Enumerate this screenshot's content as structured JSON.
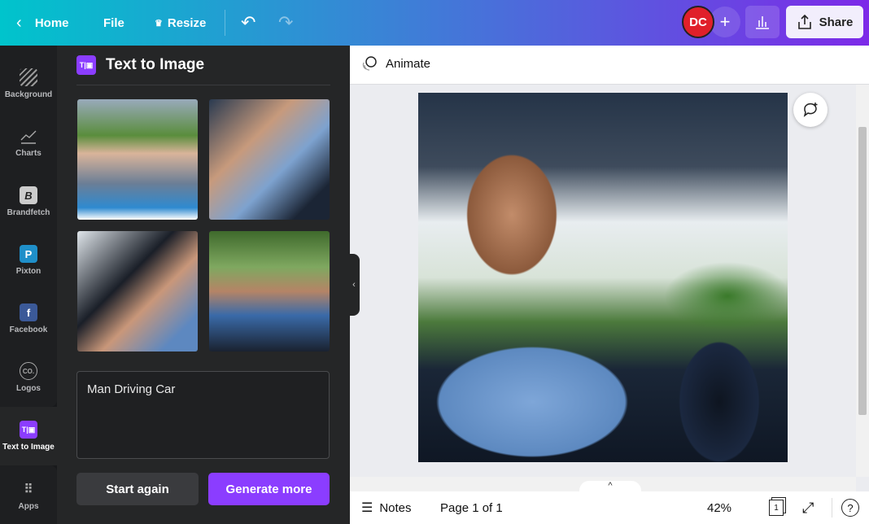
{
  "topbar": {
    "home": "Home",
    "file": "File",
    "resize": "Resize",
    "avatar_initials": "DC",
    "share": "Share"
  },
  "rail": [
    {
      "label": "Background",
      "icon": "background-icon"
    },
    {
      "label": "Charts",
      "icon": "charts-icon"
    },
    {
      "label": "Brandfetch",
      "icon": "brandfetch-icon"
    },
    {
      "label": "Pixton",
      "icon": "pixton-icon"
    },
    {
      "label": "Facebook",
      "icon": "facebook-icon"
    },
    {
      "label": "Logos",
      "icon": "logos-icon"
    },
    {
      "label": "Text to Image",
      "icon": "text-to-image-icon",
      "selected": true
    },
    {
      "label": "Apps",
      "icon": "apps-icon"
    }
  ],
  "panel": {
    "title": "Text to Image",
    "prompt": "Man Driving Car",
    "start_again": "Start again",
    "generate_more": "Generate more"
  },
  "toolbar": {
    "animate": "Animate"
  },
  "bottom": {
    "notes": "Notes",
    "page": "Page 1 of 1",
    "zoom": "42%",
    "page_count": "1"
  },
  "colors": {
    "accent": "#8b3dff",
    "panel": "#252627",
    "rail": "#18191b"
  }
}
